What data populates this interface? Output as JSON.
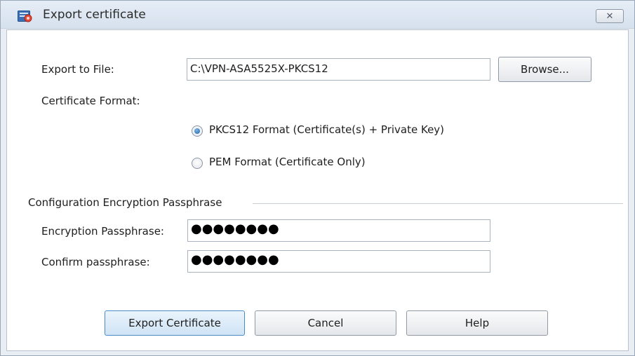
{
  "window": {
    "title": "Export certificate",
    "close_glyph": "✕"
  },
  "form": {
    "export_to_file_label": "Export to File:",
    "export_to_file_value": "C:\\VPN-ASA5525X-PKCS12",
    "browse_label": "Browse...",
    "certificate_format_label": "Certificate Format:",
    "format_options": [
      {
        "label": "PKCS12 Format (Certificate(s) + Private Key)",
        "selected": true
      },
      {
        "label": "PEM Format (Certificate Only)",
        "selected": false
      }
    ]
  },
  "passphrase_group": {
    "title": "Configuration Encryption Passphrase",
    "encryption_label": "Encryption Passphrase:",
    "encryption_value": "●●●●●●●●",
    "confirm_label": "Confirm passphrase:",
    "confirm_value": "●●●●●●●●"
  },
  "buttons": {
    "export": "Export Certificate",
    "cancel": "Cancel",
    "help": "Help"
  },
  "icons": {
    "app": "certificate-app-icon",
    "close": "close-icon"
  }
}
